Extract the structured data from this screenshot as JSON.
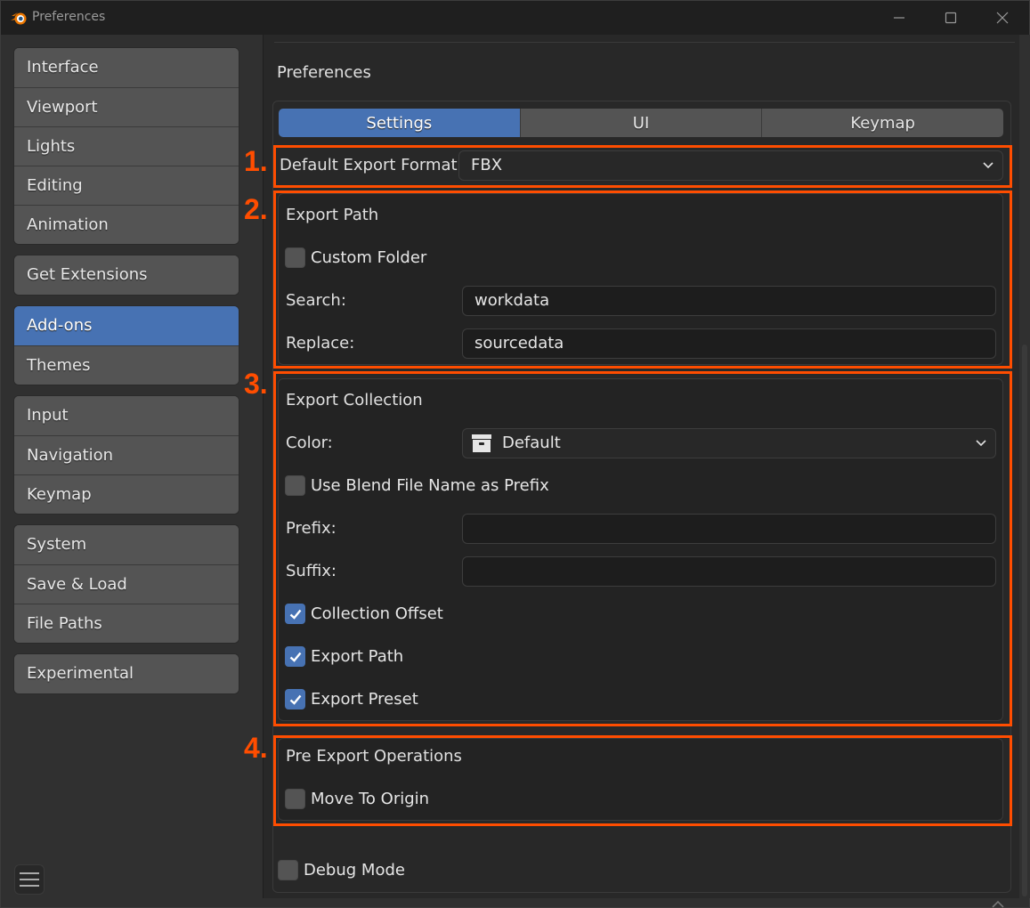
{
  "window": {
    "title": "Preferences",
    "logo_icon": "blender-logo-icon",
    "controls": [
      "minimize-icon",
      "maximize-icon",
      "close-icon"
    ]
  },
  "sidebar": {
    "groups": [
      {
        "items": [
          {
            "label": "Interface",
            "active": false
          },
          {
            "label": "Viewport",
            "active": false
          },
          {
            "label": "Lights",
            "active": false
          },
          {
            "label": "Editing",
            "active": false
          },
          {
            "label": "Animation",
            "active": false
          }
        ]
      },
      {
        "items": [
          {
            "label": "Get Extensions",
            "active": false
          }
        ]
      },
      {
        "items": [
          {
            "label": "Add-ons",
            "active": true
          },
          {
            "label": "Themes",
            "active": false
          }
        ]
      },
      {
        "items": [
          {
            "label": "Input",
            "active": false
          },
          {
            "label": "Navigation",
            "active": false
          },
          {
            "label": "Keymap",
            "active": false
          }
        ]
      },
      {
        "items": [
          {
            "label": "System",
            "active": false
          },
          {
            "label": "Save & Load",
            "active": false
          },
          {
            "label": "File Paths",
            "active": false
          }
        ]
      },
      {
        "items": [
          {
            "label": "Experimental",
            "active": false
          }
        ]
      }
    ],
    "menu_icon": "hamburger-menu-icon"
  },
  "main": {
    "heading": "Preferences",
    "tabs": [
      {
        "label": "Settings",
        "active": true
      },
      {
        "label": "UI",
        "active": false
      },
      {
        "label": "Keymap",
        "active": false
      }
    ],
    "annotations": [
      "1.",
      "2.",
      "3.",
      "4."
    ],
    "annotation_color": "#ff4d00",
    "default_export_format": {
      "label": "Default Export Format:",
      "value": "FBX"
    },
    "export_path": {
      "title": "Export Path",
      "custom_folder": {
        "label": "Custom Folder",
        "checked": false
      },
      "search": {
        "label": "Search:",
        "value": "workdata"
      },
      "replace": {
        "label": "Replace:",
        "value": "sourcedata"
      }
    },
    "export_collection": {
      "title": "Export Collection",
      "color": {
        "label": "Color:",
        "value": "Default",
        "icon": "collection-box-icon"
      },
      "use_blend_prefix": {
        "label": "Use Blend File Name as Prefix",
        "checked": false
      },
      "prefix": {
        "label": "Prefix:",
        "value": ""
      },
      "suffix": {
        "label": "Suffix:",
        "value": ""
      },
      "collection_offset": {
        "label": "Collection Offset",
        "checked": true
      },
      "export_path": {
        "label": "Export Path",
        "checked": true
      },
      "export_preset": {
        "label": "Export Preset",
        "checked": true
      }
    },
    "pre_export": {
      "title": "Pre Export Operations",
      "move_to_origin": {
        "label": "Move To Origin",
        "checked": false
      }
    },
    "debug_mode": {
      "label": "Debug Mode",
      "checked": false
    }
  },
  "colors": {
    "accent": "#4772b3",
    "button": "#545454",
    "background": "#303030",
    "panel": "#282828"
  }
}
